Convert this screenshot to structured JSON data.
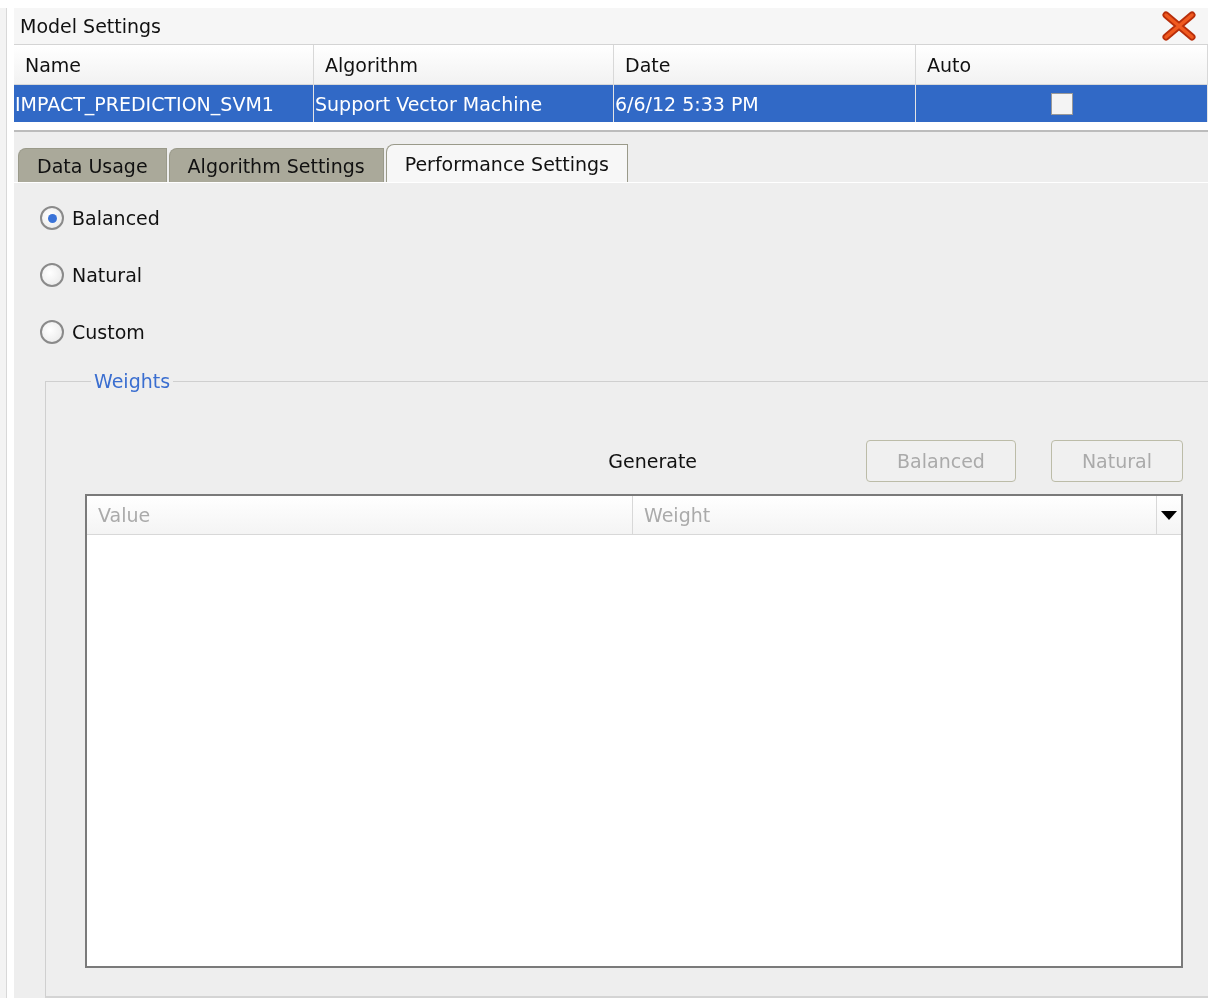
{
  "panel": {
    "title": "Model Settings"
  },
  "models": {
    "columns": [
      "Name",
      "Algorithm",
      "Date",
      "Auto"
    ],
    "rows": [
      {
        "name": "IMPACT_PREDICTION_SVM1",
        "algorithm": "Support Vector Machine",
        "date": "6/6/12 5:33 PM",
        "auto": false,
        "selected": true
      }
    ]
  },
  "tabs": [
    {
      "label": "Data Usage",
      "selected": false
    },
    {
      "label": "Algorithm Settings",
      "selected": false
    },
    {
      "label": "Performance Settings",
      "selected": true
    }
  ],
  "weighting": [
    {
      "label": "Balanced",
      "selected": true
    },
    {
      "label": "Natural",
      "selected": false
    },
    {
      "label": "Custom",
      "selected": false
    }
  ],
  "weights": {
    "title": "Weights",
    "generate_label": "Generate",
    "buttons": [
      {
        "label": "Balanced",
        "disabled": true
      },
      {
        "label": "Natural",
        "disabled": true
      }
    ],
    "columns": [
      {
        "label": "Value",
        "disabled": true
      },
      {
        "label": "Weight",
        "disabled": true
      }
    ]
  }
}
